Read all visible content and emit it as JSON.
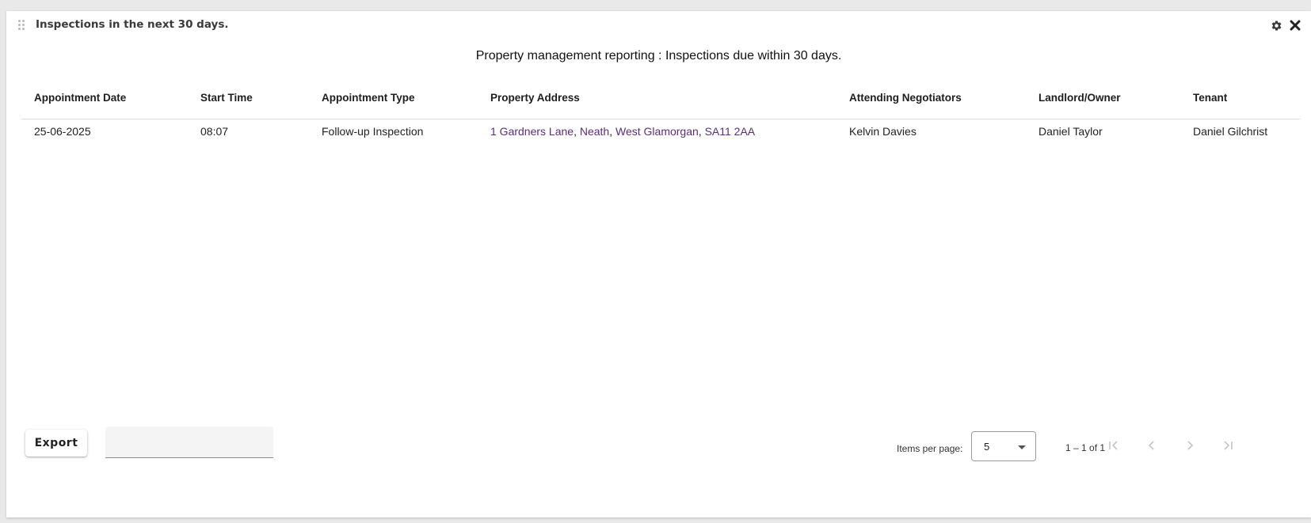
{
  "widget": {
    "title": "Inspections in the next 30 days.",
    "icons": {
      "drag": "drag-handle-icon",
      "settings": "gear-icon",
      "close": "close-icon"
    }
  },
  "report": {
    "title": "Property management reporting : Inspections due within 30 days.",
    "columns": [
      "Appointment Date",
      "Start Time",
      "Appointment Type",
      "Property Address",
      "Attending Negotiators",
      "Landlord/Owner",
      "Tenant"
    ],
    "rows": [
      {
        "date": "25-06-2025",
        "time": "08:07",
        "type": "Follow-up Inspection",
        "address_parts": [
          "1 Gardners Lane",
          "Neath",
          "West Glamorgan",
          "SA11 2AA"
        ],
        "negotiators": "Kelvin Davies",
        "landlord": "Daniel Taylor",
        "tenant": "Daniel Gilchrist"
      }
    ],
    "link_color": "#5b2d82"
  },
  "footer": {
    "export_label": "Export",
    "filter_value": "",
    "items_per_page_label": "Items per page:",
    "items_per_page_value": "5",
    "range_label": "1 – 1 of 1",
    "nav_icons": [
      "first-page-icon",
      "prev-page-icon",
      "next-page-icon",
      "last-page-icon"
    ]
  }
}
